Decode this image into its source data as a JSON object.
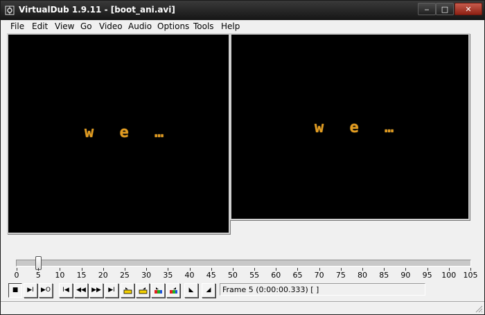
{
  "window": {
    "title": "VirtualDub 1.9.11 - [boot_ani.avi]"
  },
  "title_buttons": {
    "minimize": "‒",
    "maximize": "□",
    "close": "✕"
  },
  "menu": [
    {
      "label": "File"
    },
    {
      "label": "Edit"
    },
    {
      "label": "View"
    },
    {
      "label": "Go"
    },
    {
      "label": "Video"
    },
    {
      "label": "Audio"
    },
    {
      "label": "Options"
    },
    {
      "label": "Tools"
    },
    {
      "label": "Help"
    }
  ],
  "panes": {
    "input_text": "w e …",
    "output_text": "w e …"
  },
  "timeline": {
    "min": 0,
    "max": 105,
    "current": 5,
    "ticks": [
      "0",
      "5",
      "10",
      "15",
      "20",
      "25",
      "30",
      "35",
      "40",
      "45",
      "50",
      "55",
      "60",
      "65",
      "70",
      "75",
      "80",
      "85",
      "90",
      "95",
      "100",
      "105"
    ]
  },
  "toolbar": {
    "buttons": [
      {
        "name": "stop-button",
        "glyph": "■"
      },
      {
        "name": "play-input-button",
        "glyph": "▶I"
      },
      {
        "name": "play-output-button",
        "glyph": "▶O"
      },
      {
        "name": "go-start-button",
        "glyph": "I◀"
      },
      {
        "name": "prev-frame-button",
        "glyph": "◀◀"
      },
      {
        "name": "next-frame-button",
        "glyph": "▶▶"
      },
      {
        "name": "go-end-button",
        "glyph": "▶I"
      },
      {
        "name": "prev-keyframe-button",
        "glyph": ""
      },
      {
        "name": "next-keyframe-button",
        "glyph": ""
      },
      {
        "name": "prev-scene-button",
        "glyph": ""
      },
      {
        "name": "next-scene-button",
        "glyph": ""
      },
      {
        "name": "mark-in-button",
        "glyph": "◣"
      },
      {
        "name": "mark-out-button",
        "glyph": "◢"
      }
    ],
    "frame_status": "Frame 5 (0:00:00.333) [ ]"
  }
}
